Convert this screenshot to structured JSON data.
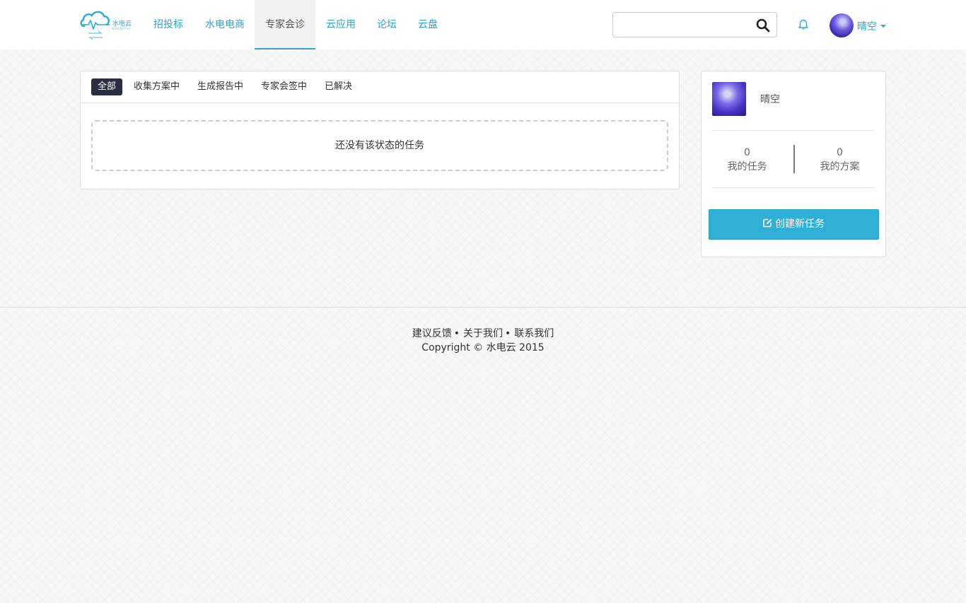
{
  "logo": {
    "text": "水电云",
    "subtext": "WEBWATER",
    "brand_color": "#29a9d6"
  },
  "nav": {
    "items": [
      {
        "label": "招投标",
        "active": false
      },
      {
        "label": "水电电商",
        "active": false
      },
      {
        "label": "专家会诊",
        "active": true
      },
      {
        "label": "云应用",
        "active": false
      },
      {
        "label": "论坛",
        "active": false
      },
      {
        "label": "云盘",
        "active": false
      }
    ],
    "accent_color": "#2fa4cf"
  },
  "search": {
    "value": "",
    "placeholder": "",
    "icon": "search-icon"
  },
  "notifications": {
    "icon": "bell-icon"
  },
  "user": {
    "name": "晴空",
    "icon": "chevron-down-icon"
  },
  "tabs": [
    {
      "label": "全部",
      "active": true
    },
    {
      "label": "收集方案中",
      "active": false
    },
    {
      "label": "生成报告中",
      "active": false
    },
    {
      "label": "专家会签中",
      "active": false
    },
    {
      "label": "已解决",
      "active": false
    }
  ],
  "empty_message": "还没有该状态的任务",
  "profile": {
    "name": "晴空",
    "stats": [
      {
        "value": "0",
        "label": "我的任务"
      },
      {
        "value": "0",
        "label": "我的方案"
      }
    ],
    "create_button": "创建新任务",
    "create_icon": "edit-icon",
    "button_color": "#30b0d6"
  },
  "footer": {
    "links": [
      "建议反馈",
      "关于我们",
      "联系我们"
    ],
    "separator": "•",
    "copyright": "Copyright © 水电云 2015"
  }
}
